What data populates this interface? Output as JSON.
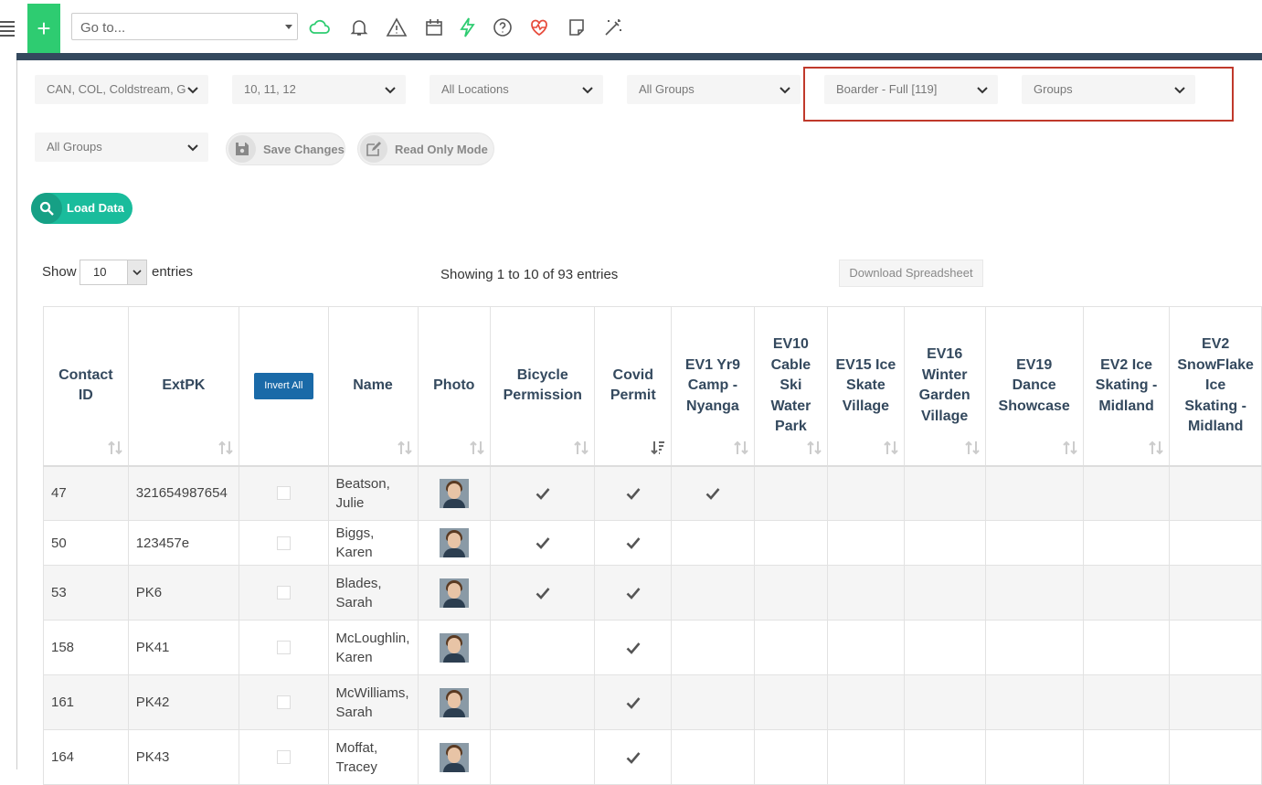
{
  "topbar": {
    "goto_placeholder": "Go to...",
    "icons": [
      "menu-icon",
      "plus-icon",
      "cloud-icon",
      "bell-icon",
      "warning-icon",
      "calendar-icon",
      "lightning-icon",
      "help-icon",
      "heartbeat-icon",
      "note-icon",
      "magic-wand-icon"
    ]
  },
  "filters": {
    "campus": "CAN, COL, Coldstream, GA",
    "years": "10, 11, 12",
    "locations": "All Locations",
    "groups1": "All Groups",
    "boarder": "Boarder - Full [119]",
    "groups2": "Groups",
    "groups3": "All Groups"
  },
  "actions": {
    "save": "Save Changes",
    "read_only": "Read Only Mode",
    "load": "Load Data"
  },
  "table_controls": {
    "show": "Show",
    "entries_value": "10",
    "entries": "entries",
    "info": "Showing 1 to 10 of 93 entries",
    "download": "Download Spreadsheet"
  },
  "columns": {
    "contact_id": "Contact ID",
    "extpk": "ExtPK",
    "invert": "Invert All",
    "name": "Name",
    "photo": "Photo",
    "bicycle": "Bicycle Permission",
    "covid": "Covid Permit",
    "ev1": "EV1 Yr9 Camp - Nyanga",
    "ev10": "EV10 Cable Ski Water Park",
    "ev15": "EV15 Ice Skate Village",
    "ev16": "EV16 Winter Garden Village",
    "ev19": "EV19 Dance Showcase",
    "ev2ice": "EV2 Ice Skating - Midland",
    "ev2snow": "EV2 SnowFlake Ice Skating - Midland"
  },
  "rows": [
    {
      "id": "47",
      "extpk": "321654987654",
      "name": "Beatson, Julie",
      "bicycle": true,
      "covid": true,
      "ev1": true
    },
    {
      "id": "50",
      "extpk": "123457e",
      "name": "Biggs, Karen",
      "bicycle": true,
      "covid": true,
      "ev1": false
    },
    {
      "id": "53",
      "extpk": "PK6",
      "name": "Blades, Sarah",
      "bicycle": true,
      "covid": true,
      "ev1": false
    },
    {
      "id": "158",
      "extpk": "PK41",
      "name": "McLoughlin, Karen",
      "bicycle": false,
      "covid": true,
      "ev1": false
    },
    {
      "id": "161",
      "extpk": "PK42",
      "name": "McWilliams, Sarah",
      "bicycle": false,
      "covid": true,
      "ev1": false
    },
    {
      "id": "164",
      "extpk": "PK43",
      "name": "Moffat, Tracey",
      "bicycle": false,
      "covid": true,
      "ev1": false
    }
  ]
}
